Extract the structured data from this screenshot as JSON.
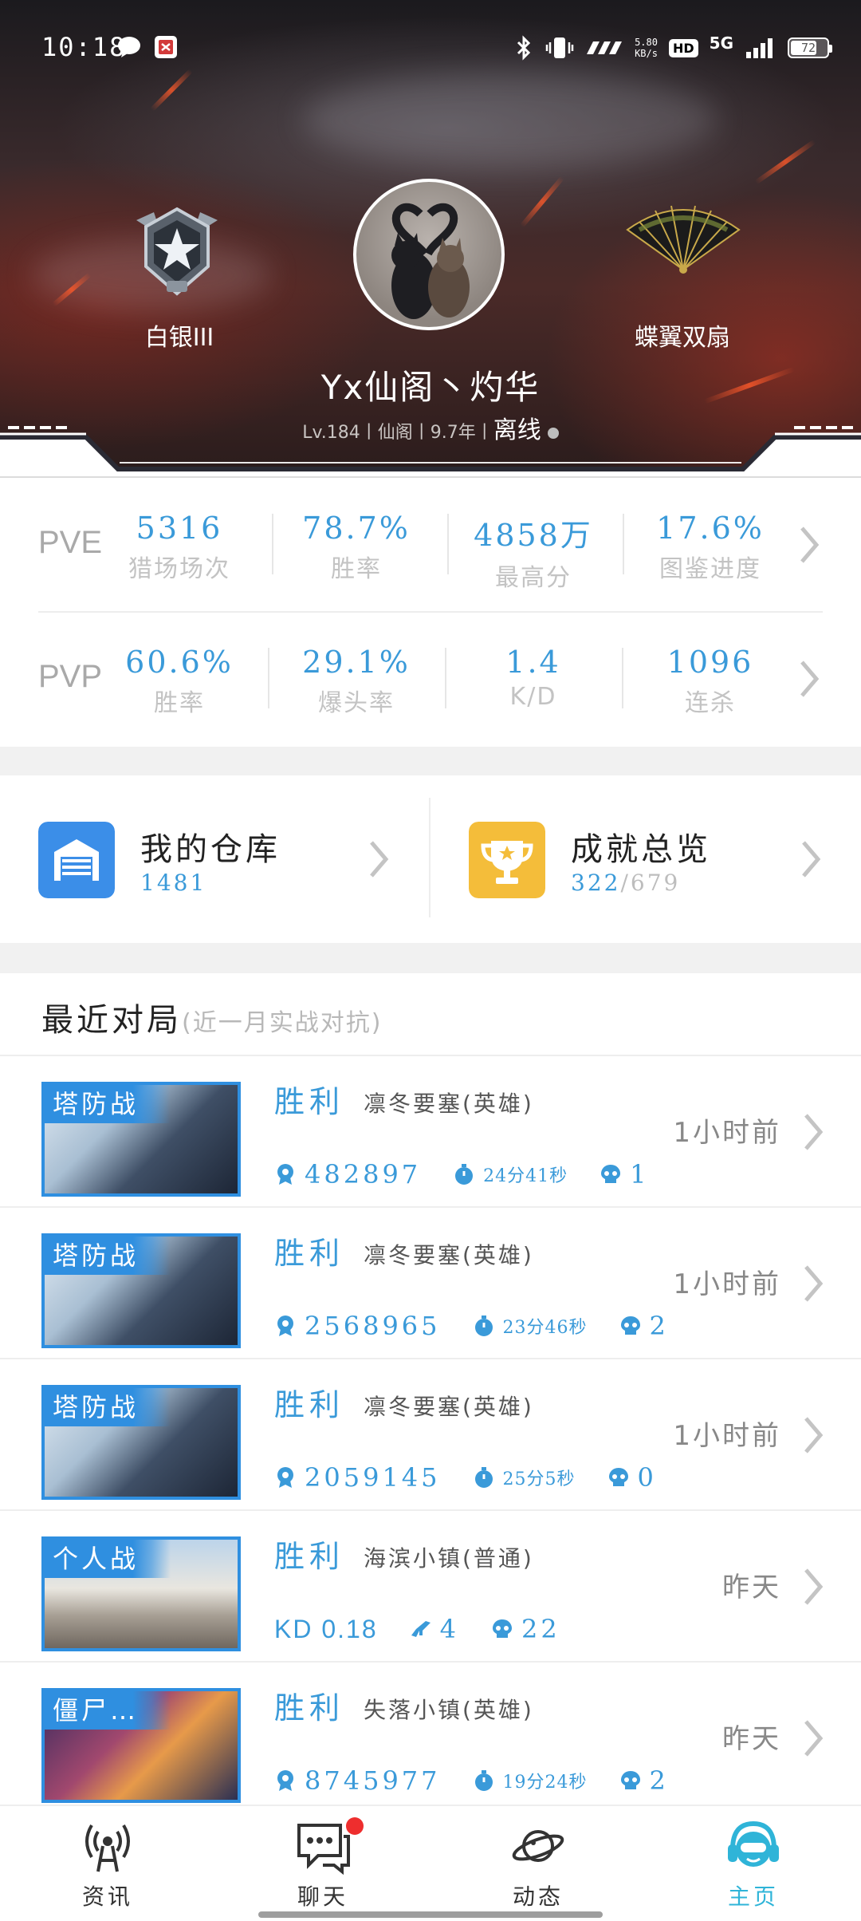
{
  "status_bar": {
    "time": "10:18",
    "net_speed_value": "5.80",
    "net_speed_unit": "KB/s",
    "hd": "HD",
    "signal": "5G",
    "battery": "72"
  },
  "profile": {
    "rank_label": "白银III",
    "weapon_label": "蝶翼双扇",
    "nickname": "Yx仙阁丶灼华",
    "sub_info": "Lv.184丨仙阁丨9.7年丨",
    "status": "离线"
  },
  "pve": {
    "label": "PVE",
    "stats": [
      {
        "value": "5316",
        "label": "猎场场次"
      },
      {
        "value": "78.7%",
        "label": "胜率"
      },
      {
        "value": "4858万",
        "label": "最高分"
      },
      {
        "value": "17.6%",
        "label": "图鉴进度"
      }
    ]
  },
  "pvp": {
    "label": "PVP",
    "stats": [
      {
        "value": "60.6%",
        "label": "胜率"
      },
      {
        "value": "29.1%",
        "label": "爆头率"
      },
      {
        "value": "1.4",
        "label": "K/D"
      },
      {
        "value": "1096",
        "label": "连杀"
      }
    ]
  },
  "tiles": {
    "warehouse": {
      "title": "我的仓库",
      "count": "1481"
    },
    "achievements": {
      "title": "成就总览",
      "done": "322",
      "total": "/679"
    }
  },
  "recent": {
    "title": "最近对局",
    "subtitle": "(近一月实战对抗)",
    "matches": [
      {
        "mode": "塔防战",
        "result": "胜利",
        "map": "凛冬要塞(英雄)",
        "time": "1小时前",
        "score": "482897",
        "duration": "24分41秒",
        "deaths": "1"
      },
      {
        "mode": "塔防战",
        "result": "胜利",
        "map": "凛冬要塞(英雄)",
        "time": "1小时前",
        "score": "2568965",
        "duration": "23分46秒",
        "deaths": "2"
      },
      {
        "mode": "塔防战",
        "result": "胜利",
        "map": "凛冬要塞(英雄)",
        "time": "1小时前",
        "score": "2059145",
        "duration": "25分5秒",
        "deaths": "0"
      },
      {
        "mode": "个人战",
        "result": "胜利",
        "map": "海滨小镇(普通)",
        "time": "昨天",
        "kd": "KD 0.18",
        "kills": "4",
        "deaths": "22"
      },
      {
        "mode": "僵尸…",
        "result": "胜利",
        "map": "失落小镇(英雄)",
        "time": "昨天",
        "score": "8745977",
        "duration": "19分24秒",
        "deaths": "2"
      }
    ]
  },
  "nav": {
    "items": [
      {
        "label": "资讯"
      },
      {
        "label": "聊天"
      },
      {
        "label": "动态"
      },
      {
        "label": "主页"
      }
    ],
    "active_color": "#2fb4d8"
  },
  "colors": {
    "accent": "#3a9ad9",
    "tag_blue": "#2f8fe0",
    "warehouse_icon": "#3b8ee8",
    "trophy_icon": "#f4bd3a",
    "notification": "#ee2e2e"
  }
}
